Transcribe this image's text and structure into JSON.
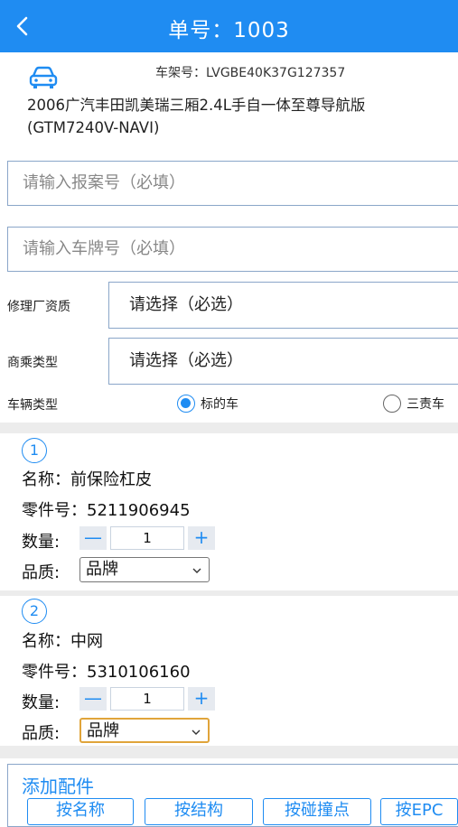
{
  "header": {
    "title": "单号：1003"
  },
  "vehicle": {
    "vin": "车架号：LVGBE40K37G127357",
    "model_line1": "2006广汽丰田凯美瑞三厢2.4L手自一体至尊导航版",
    "model_line2": "(GTM7240V-NAVI)"
  },
  "inputs": {
    "claim_placeholder": "请输入报案号（必填）",
    "plate_placeholder": "请输入车牌号（必填）"
  },
  "repair_shop": {
    "label": "修理厂资质",
    "value": "请选择（必选）"
  },
  "vehicle_usage": {
    "label": "商乘类型",
    "value": "请选择（必选）"
  },
  "vehicle_type": {
    "label": "车辆类型",
    "option1": "标的车",
    "option2": "三责车",
    "selected": "标的车"
  },
  "parts": [
    {
      "index": "1",
      "name": "名称：前保险杠皮",
      "code": "零件号：5211906945",
      "qty_label": "数量:",
      "qty": "1",
      "quality_label": "品质:",
      "quality": "品牌"
    },
    {
      "index": "2",
      "name": "名称：中网",
      "code": "零件号：5310106160",
      "qty_label": "数量:",
      "qty": "1",
      "quality_label": "品质:",
      "quality": "品牌"
    }
  ],
  "stepper": {
    "minus": "—",
    "plus": "+"
  },
  "add_parts": {
    "title": "添加配件",
    "buttons": [
      "按名称",
      "按结构",
      "按碰撞点",
      "按EPC"
    ]
  },
  "colors": {
    "accent": "#1f8cf2",
    "focus": "#e0a43a"
  }
}
